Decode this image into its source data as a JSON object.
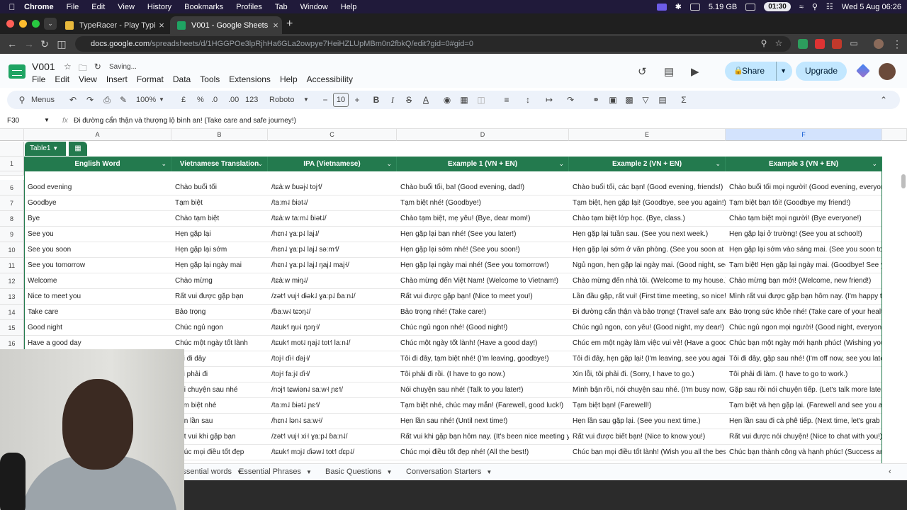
{
  "os_menubar": {
    "app": "Chrome",
    "items": [
      "File",
      "Edit",
      "View",
      "History",
      "Bookmarks",
      "Profiles",
      "Tab",
      "Window",
      "Help"
    ],
    "memory": "5.19 GB",
    "timer": "01:30",
    "datetime": "Wed 5 Aug  06:26"
  },
  "browser": {
    "tabs": [
      {
        "title": "TypeRacer - Play Typing Gam",
        "active": false
      },
      {
        "title": "V001 - Google Sheets",
        "active": true
      }
    ],
    "url_host": "docs.google.com",
    "url_path": "/spreadsheets/d/1HGGPOe3lpRjhHa6GLa2owpye7HeiHZLUpMBm0n2fbkQ/edit?gid=0#gid=0"
  },
  "sheets": {
    "title": "V001",
    "status": "Saving...",
    "menus": [
      "File",
      "Edit",
      "View",
      "Insert",
      "Format",
      "Data",
      "Tools",
      "Extensions",
      "Help",
      "Accessibility"
    ],
    "share_label": "Share",
    "upgrade_label": "Upgrade",
    "toolbar": {
      "search_label": "Menus",
      "zoom": "100%",
      "currency": "£",
      "percent": "%",
      "dec_decrease": ".0",
      "dec_increase": ".00",
      "number_format": "123",
      "font": "Roboto",
      "font_size": "10"
    },
    "name_box": "F30",
    "formula": "Đi đường cẩn thận và thượng lộ bình an! (Take care and safe journey!)",
    "columns": [
      "A",
      "B",
      "C",
      "D",
      "E",
      "F"
    ],
    "selected_column": "F",
    "table_name": "Table1",
    "header_row_number": "1",
    "headers": [
      "English Word",
      "Vietnamese Translation",
      "IPA (Vietnamese)",
      "Example 1 (VN + EN)",
      "Example 2 (VN + EN)",
      "Example 3 (VN + EN)"
    ],
    "rows": [
      {
        "n": "6",
        "cells": [
          "Good evening",
          "Chào buổi tối",
          "/tɕàːw ɓuəj˧˩ toj˧˥/",
          "Chào buổi tối, ba! (Good evening, dad!)",
          "Chào buổi tối, các bạn! (Good evening, friends!)",
          "Chào buổi tối mọi người! (Good evening, everyone!)"
        ]
      },
      {
        "n": "7",
        "cells": [
          "Goodbye",
          "Tạm biệt",
          "/taːm˨˩ ɓiət˨˩/",
          "Tạm biệt nhé! (Goodbye!)",
          "Tạm biệt, hẹn gặp lại! (Goodbye, see you again!)",
          "Tạm biệt bạn tôi! (Goodbye my friend!)"
        ]
      },
      {
        "n": "8",
        "cells": [
          "Bye",
          "Chào tạm biệt",
          "/tɕàːw taːm˨˩ ɓiət˨˩/",
          "Chào tạm biệt, mẹ yêu! (Bye, dear mom!)",
          "Chào tạm biệt lớp học. (Bye, class.)",
          "Chào tạm biệt mọi người! (Bye everyone!)"
        ]
      },
      {
        "n": "9",
        "cells": [
          "See you",
          "Hẹn gặp lại",
          "/hɛn˨˩ ɣaːp˨˩ laj˨˩/",
          "Hẹn gặp lại bạn nhé! (See you later!)",
          "Hẹn gặp lại tuần sau. (See you next week.)",
          "Hẹn gặp lại ở trường! (See you at school!)"
        ]
      },
      {
        "n": "10",
        "cells": [
          "See you soon",
          "Hẹn gặp lại sớm",
          "/hɛn˨˩ ɣaːp˨˩ laj˨˩ səːm˧˥/",
          "Hẹn gặp lại sớm nhé! (See you soon!)",
          "Hẹn gặp lại sớm ở văn phòng. (See you soon at the office.)",
          "Hẹn gặp lại sớm vào sáng mai. (See you soon tomorrow morning.)"
        ]
      },
      {
        "n": "11",
        "cells": [
          "See you tomorrow",
          "Hẹn gặp lại ngày mai",
          "/hɛn˨˩ ɣaːp˨˩ laj˨˩ ŋaj˨˩ maj˧/",
          "Hẹn gặp lại ngày mai nhé! (See you tomorrow!)",
          "Ngủ ngon, hẹn gặp lại ngày mai. (Good night, see you tomorrow.)",
          "Tạm biệt! Hẹn gặp lại ngày mai. (Goodbye! See you tomorrow.)"
        ]
      },
      {
        "n": "12",
        "cells": [
          "Welcome",
          "Chào mừng",
          "/tɕàːw mɨŋ˨˩/",
          "Chào mừng đến Việt Nam! (Welcome to Vietnam!)",
          "Chào mừng đến nhà tôi. (Welcome to my house.)",
          "Chào mừng bạn mới! (Welcome, new friend!)"
        ]
      },
      {
        "n": "13",
        "cells": [
          "Nice to meet you",
          "Rất vui được gặp bạn",
          "/zət˧˥ vuj˧ ɗɨək˨˩ ɣaːp˨˩ ɓaːn˨˩/",
          "Rất vui được gặp bạn! (Nice to meet you!)",
          "Lần đầu gặp, rất vui! (First time meeting, so nice!)",
          "Mình rất vui được gặp bạn hôm nay. (I'm happy to meet you today.)"
        ]
      },
      {
        "n": "14",
        "cells": [
          "Take care",
          "Bảo trọng",
          "/ɓaːw˧˩ tɕɔŋ˨˩/",
          "Bảo trọng nhé! (Take care!)",
          "Đi đường cẩn thận và bảo trọng! (Travel safe and take care!)",
          "Bảo trọng sức khỏe nhé! (Take care of your health!)"
        ]
      },
      {
        "n": "15",
        "cells": [
          "Good night",
          "Chúc ngủ ngon",
          "/tɕuk˧˥ ŋu˧˩ ŋɔŋ˧/",
          "Chúc ngủ ngon nhé! (Good night!)",
          "Chúc ngủ ngon, con yêu! (Good night, my dear!)",
          "Chúc ngủ ngon mọi người! (Good night, everyone!)"
        ]
      },
      {
        "n": "16",
        "cells": [
          "Have a good day",
          "Chúc một ngày tốt lành",
          "/tɕuk˧˥ mot˨˩ ŋaj˨˩ tot˧˥ laːn˨˩/",
          "Chúc một ngày tốt lành! (Have a good day!)",
          "Chúc em một ngày làm việc vui vẻ! (Have a good workday!)",
          "Chúc bạn một ngày mới hạnh phúc! (Wishing you a happy new day!)"
        ]
      },
      {
        "n": "17",
        "cells": [
          "",
          "Tôi đi đây",
          "/toj˧ ɗi˧ ɗəj˧/",
          "Tôi đi đây, tạm biệt nhé! (I'm leaving, goodbye!)",
          "Tôi đi đây, hẹn gặp lại! (I'm leaving, see you again!)",
          "Tôi đi đây, gặp sau nhé! (I'm off now, see you later!)"
        ]
      },
      {
        "n": "18",
        "cells": [
          "",
          "Tôi phải đi",
          "/toj˧ faːj˧˩ ɗi˧/",
          "Tôi phải đi rồi. (I have to go now.)",
          "Xin lỗi, tôi phải đi. (Sorry, I have to go.)",
          "Tôi phải đi làm. (I have to go to work.)"
        ]
      },
      {
        "n": "19",
        "cells": [
          "",
          "Nói chuyện sau nhé",
          "/nɔj˧˥ tɕwiən˨˩ saːw˧ ɲɛ˧˥/",
          "Nói chuyện sau nhé! (Talk to you later!)",
          "Mình bận rồi, nói chuyện sau nhé. (I'm busy now, talk later.)",
          "Gặp sau rồi nói chuyện tiếp. (Let's talk more later.)"
        ]
      },
      {
        "n": "20",
        "cells": [
          "",
          "Tạm biệt nhé",
          "/taːm˨˩ ɓiət˨˩ ɲɛ˧˥/",
          "Tạm biệt nhé, chúc may mắn! (Farewell, good luck!)",
          "Tạm biệt bạn! (Farewell!)",
          "Tạm biệt và hẹn gặp lại. (Farewell and see you again.)"
        ]
      },
      {
        "n": "21",
        "cells": [
          "",
          "Hẹn lần sau",
          "/hɛn˨˩ lən˨˩ saːw˧/",
          "Hẹn lần sau nhé! (Until next time!)",
          "Hẹn lần sau gặp lại. (See you next time.)",
          "Hẹn lần sau đi cà phê tiếp. (Next time, let's grab coffee again.)"
        ]
      },
      {
        "n": "22",
        "cells": [
          "",
          "Rất vui khi gặp bạn",
          "/zət˧˥ vuj˧ xi˧ ɣaːp˨˩ ɓaːn˨˩/",
          "Rất vui khi gặp bạn hôm nay. (It's been nice meeting you today.)",
          "Rất vui được biết bạn! (Nice to know you!)",
          "Rất vui được nói chuyện! (Nice to chat with you!)"
        ]
      },
      {
        "n": "23",
        "cells": [
          "",
          "Chúc mọi điều tốt đẹp",
          "/tɕuk˧˥ mɔj˨˩ ɗiəw˨˩ tot˧˥ ɗɛp˨˩/",
          "Chúc mọi điều tốt đẹp nhé! (All the best!)",
          "Chúc bạn mọi điều tốt lành! (Wish you all the best!)",
          "Chúc bạn thành công và hạnh phúc! (Success and happiness!)"
        ]
      }
    ],
    "sheet_tabs": [
      "Essential words",
      "Essential Phrases",
      "Basic Questions",
      "Conversation Starters"
    ]
  }
}
